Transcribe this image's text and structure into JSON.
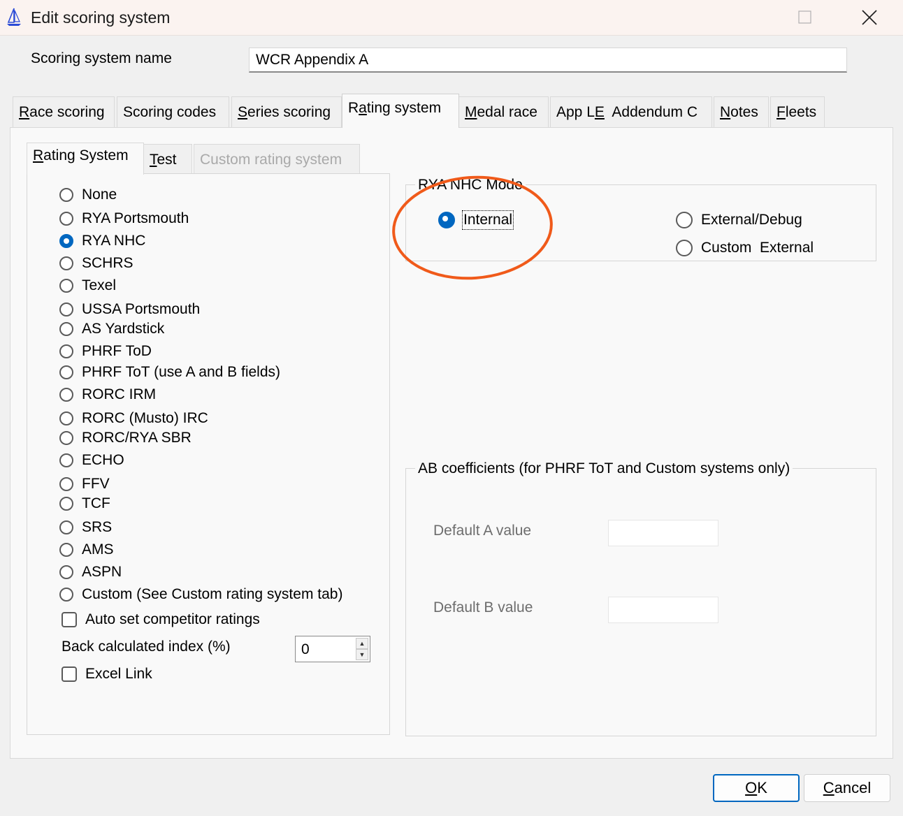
{
  "window": {
    "title": "Edit scoring system",
    "minimize_icon": "minimize-icon",
    "maximize_icon": "maximize-icon",
    "close_icon": "close-icon",
    "app_icon": "sailboat-icon"
  },
  "name_field": {
    "label": "Scoring system name",
    "value": "WCR Appendix A"
  },
  "tabs": [
    {
      "label": "Race scoring",
      "mnemonic": "R",
      "rest": "ace scoring"
    },
    {
      "label": "Scoring codes",
      "mnemonic": "",
      "rest": "Scoring codes"
    },
    {
      "label": "Series scoring",
      "mnemonic": "S",
      "rest": "eries scoring"
    },
    {
      "label": "Rating system",
      "pre": "R",
      "mnemonic": "a",
      "rest": "ting system",
      "active": true
    },
    {
      "label": "Medal race",
      "mnemonic": "M",
      "rest": "edal race"
    },
    {
      "label": "App LE  Addendum C",
      "pre": "App L",
      "mnemonic": "E",
      "rest": "  Addendum C"
    },
    {
      "label": "Notes",
      "mnemonic": "N",
      "rest": "otes"
    },
    {
      "label": "Fleets",
      "mnemonic": "F",
      "rest": "leets"
    }
  ],
  "inner_tabs": [
    {
      "label": "Rating System",
      "mnemonic": "R",
      "rest": "ating System",
      "active": true
    },
    {
      "label": "Test",
      "mnemonic": "T",
      "rest": "est"
    },
    {
      "label": "Custom rating system",
      "disabled": true
    }
  ],
  "rating_options": [
    {
      "label": "None",
      "checked": false
    },
    {
      "label": "RYA Portsmouth",
      "checked": false
    },
    {
      "label": "RYA NHC",
      "checked": true
    },
    {
      "label": "SCHRS",
      "checked": false
    },
    {
      "label": "Texel",
      "checked": false
    },
    {
      "label": "USSA Portsmouth",
      "checked": false
    },
    {
      "label": "AS Yardstick",
      "checked": false
    },
    {
      "label": "PHRF ToD",
      "checked": false
    },
    {
      "label": "PHRF ToT (use A and B fields)",
      "checked": false
    },
    {
      "label": "RORC IRM",
      "checked": false
    },
    {
      "label": "RORC (Musto) IRC",
      "checked": false
    },
    {
      "label": "RORC/RYA SBR",
      "checked": false
    },
    {
      "label": "ECHO",
      "checked": false
    },
    {
      "label": "FFV",
      "checked": false
    },
    {
      "label": "TCF",
      "checked": false
    },
    {
      "label": "SRS",
      "checked": false
    },
    {
      "label": "AMS",
      "checked": false
    },
    {
      "label": "ASPN",
      "checked": false
    },
    {
      "label": "Custom (See Custom rating system tab)",
      "checked": false
    }
  ],
  "auto_set": {
    "label": "Auto set competitor ratings",
    "checked": false
  },
  "back_calc": {
    "label": "Back calculated index (%)",
    "value": "0"
  },
  "excel_link": {
    "label": "Excel Link",
    "checked": false
  },
  "nhc_mode": {
    "group_label": "RYA NHC Mode",
    "options": [
      {
        "label": "Internal",
        "checked": true
      },
      {
        "label": "External/Debug",
        "checked": false
      },
      {
        "label": "Custom  External",
        "checked": false
      }
    ],
    "annotation_color": "#f05a1a"
  },
  "ab_coeff": {
    "group_label": "AB coefficients (for PHRF ToT and Custom systems only)",
    "default_a_label": "Default A value",
    "default_a_value": "",
    "default_b_label": "Default B value",
    "default_b_value": ""
  },
  "buttons": {
    "ok": {
      "mnemonic": "O",
      "rest": "K"
    },
    "cancel": {
      "mnemonic": "C",
      "rest": "ancel"
    }
  },
  "colors": {
    "accent": "#0067c0",
    "annotation": "#f05a1a"
  }
}
